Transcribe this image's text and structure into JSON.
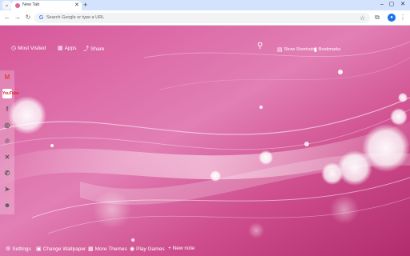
{
  "browser": {
    "tab_search_icon": "chevron-down-icon",
    "tab": {
      "title": "New Tab",
      "close_icon": "close-icon"
    },
    "new_tab_label": "+",
    "window_controls": {
      "minimize": "–",
      "maximize": "▢",
      "close": "✕"
    },
    "omnibox": {
      "placeholder": "Search Google or type a URL"
    }
  },
  "top_links": {
    "most_visited": "Most Visited",
    "apps": "Apps",
    "share": "Share",
    "show_shortcuts": "Show Shortcuts",
    "bookmarks": "Bookmarks"
  },
  "social_bar": {
    "items": [
      "gmail",
      "youtube",
      "facebook",
      "instagram",
      "pinterest",
      "x",
      "whatsapp",
      "telegram",
      "reddit"
    ],
    "youtube_label": "YouTube"
  },
  "bottom_bar": {
    "settings": "Settings",
    "change_wallpaper": "Change Wallpaper",
    "more_themes": "More Themes",
    "play_games": "Play Games",
    "new_note": "+ New note"
  },
  "colors": {
    "page_accent": "#c2427f",
    "tabstrip": "#d3e3fd",
    "profile": "#1a73e8"
  }
}
